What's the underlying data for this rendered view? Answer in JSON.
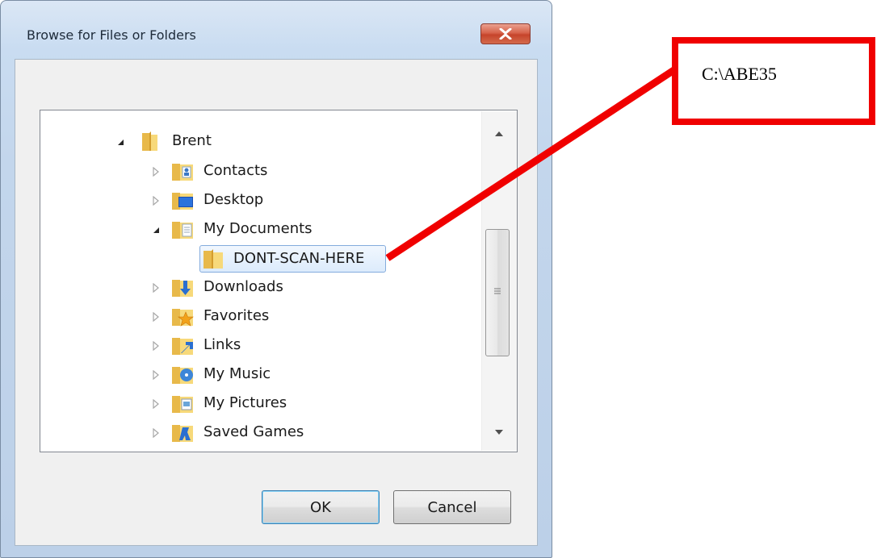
{
  "dialog": {
    "title": "Browse for Files or Folders",
    "close_icon": "close-x-icon"
  },
  "tree": {
    "items": [
      {
        "label": "Brent",
        "icon": "user-folder-icon",
        "expander": "expanded"
      },
      {
        "label": "Contacts",
        "icon": "contacts-folder-icon",
        "expander": "collapsed"
      },
      {
        "label": "Desktop",
        "icon": "desktop-folder-icon",
        "expander": "collapsed"
      },
      {
        "label": "My Documents",
        "icon": "documents-folder-icon",
        "expander": "expanded"
      },
      {
        "label": "DONT-SCAN-HERE",
        "icon": "folder-icon",
        "expander": "none",
        "selected": true
      },
      {
        "label": "Downloads",
        "icon": "downloads-folder-icon",
        "expander": "collapsed"
      },
      {
        "label": "Favorites",
        "icon": "favorites-folder-icon",
        "expander": "collapsed"
      },
      {
        "label": "Links",
        "icon": "links-folder-icon",
        "expander": "collapsed"
      },
      {
        "label": "My Music",
        "icon": "music-folder-icon",
        "expander": "collapsed"
      },
      {
        "label": "My Pictures",
        "icon": "pictures-folder-icon",
        "expander": "collapsed"
      },
      {
        "label": "Saved Games",
        "icon": "saved-games-folder-icon",
        "expander": "collapsed"
      }
    ]
  },
  "buttons": {
    "ok_label": "OK",
    "cancel_label": "Cancel"
  },
  "annotation": {
    "text": "C:\\ABE35",
    "color": "#f00000"
  }
}
